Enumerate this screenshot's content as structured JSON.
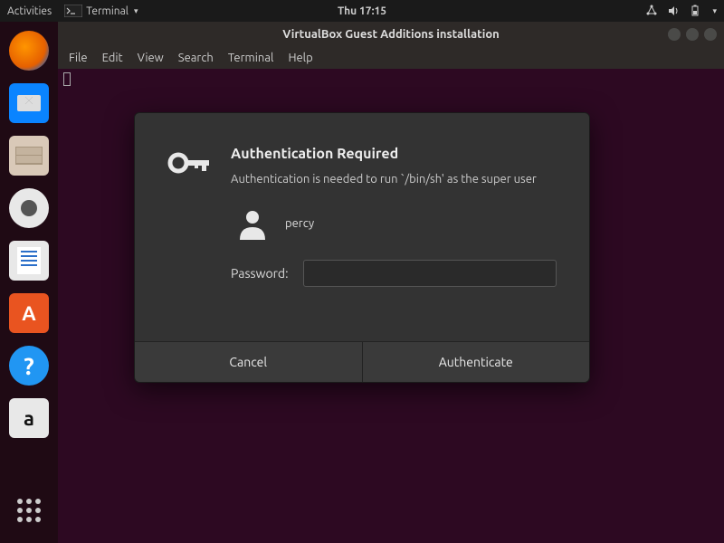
{
  "topbar": {
    "activities": "Activities",
    "app_label": "Terminal",
    "clock": "Thu 17:15"
  },
  "window": {
    "title": "VirtualBox Guest Additions installation"
  },
  "menubar": {
    "file": "File",
    "edit": "Edit",
    "view": "View",
    "search": "Search",
    "terminal": "Terminal",
    "help": "Help"
  },
  "auth": {
    "title": "Authentication Required",
    "message": "Authentication is needed to run `/bin/sh' as the super user",
    "username": "percy",
    "password_label": "Password:",
    "password_value": "",
    "cancel": "Cancel",
    "authenticate": "Authenticate"
  },
  "dock": {
    "items": [
      "firefox",
      "thunderbird",
      "files",
      "rhythmbox",
      "writer",
      "software",
      "help",
      "amazon"
    ]
  }
}
